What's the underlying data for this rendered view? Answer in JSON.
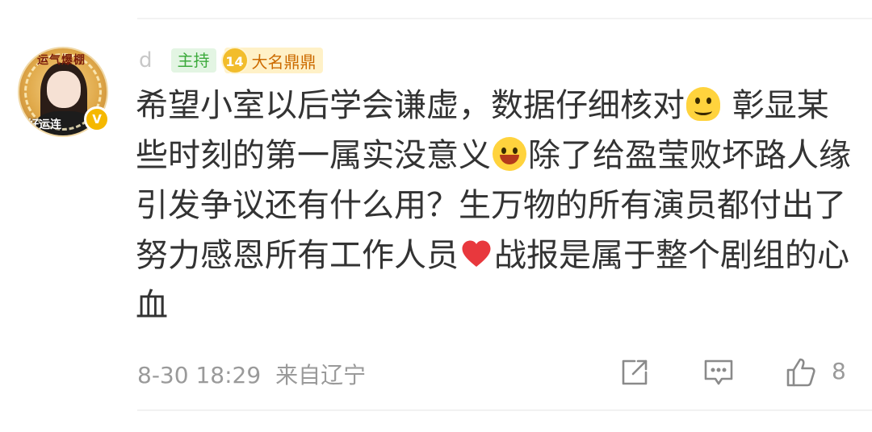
{
  "user": {
    "name": "d",
    "avatar_text_top": "运气爆棚",
    "avatar_text_bottom": "好运连",
    "verify_badge": "V",
    "host_tag": "主持",
    "fan_level": "14",
    "fan_name": "大名鼎鼎"
  },
  "comment": {
    "segments": [
      "希望小室以后学会谦虚，数据仔细核对",
      "彰显某些时刻的第一属实没意义",
      "除了给盈莹败坏路人缘引发争议还有什么用？生万物的所有演员都付出了努力感恩所有工作人员",
      "战报是属于整个剧组的心血"
    ],
    "emojis": [
      "melting-face-icon",
      "laughing-crying-icon",
      "heart-icon"
    ]
  },
  "footer": {
    "time": "8-30 18:29",
    "location": "来自辽宁",
    "like_count": "8"
  },
  "colors": {
    "host_tag_bg": "#e3f5e3",
    "host_tag_text": "#3caa3c",
    "fan_tag_bg": "#fff1c7",
    "fan_tag_text": "#cc6b00",
    "meta_text": "#9a9a9a",
    "comment_text": "#333333"
  }
}
